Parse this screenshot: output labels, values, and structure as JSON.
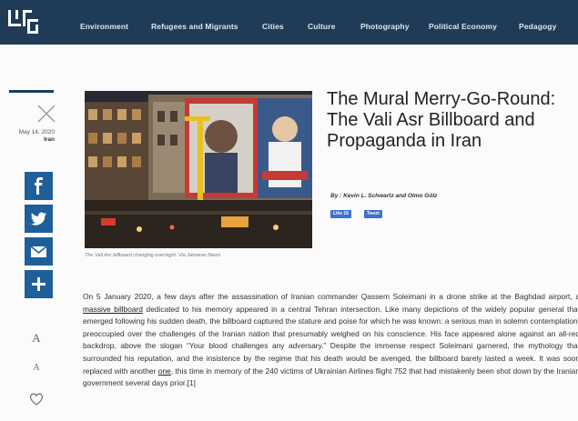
{
  "nav": {
    "items": [
      "Environment",
      "Refugees and Migrants",
      "Cities",
      "Culture",
      "Photography",
      "Political Economy",
      "Pedagogy"
    ]
  },
  "article": {
    "date": "May 14, 2020",
    "country": "Iran",
    "title": "The Mural Merry-Go-Round: The Vali Asr Billboard and Propaganda in Iran",
    "byline": "By : Kevin L. Schwartz and Olmo Gölz",
    "like_label": "Like 16",
    "tweet_label": "Tweet",
    "caption": "The Vali Asr billboard changing overnight. Via Jamaran News.",
    "body": {
      "p1": "On 5 January 2020, a few days after the assassination of Iranian commander Qassem Soleimani in a drone strike at the Baghdad airport, a ",
      "link1": "massive billboard",
      "p2": " dedicated to his memory appeared in a central Tehran intersection. Like many depictions of the widely popular general that emerged following his sudden death, the billboard captured the stature and poise for which he was known: a serious man in solemn contemplation, preoccupied over the challenges of the Iranian nation that presumably weighed on his conscience. His face appeared alone against an all-red backdrop, above the slogan “Your blood challenges any adversary.” Despite the immense respect Soleimani garnered, the mythology that surrounded his reputation, and the insistence by the regime that his death would be avenged, the billboard barely lasted a week. It was soon replaced with another ",
      "link2": "one",
      "p3": ", this time in memory of the 240 victims of Ukrainian Airlines flight 752 that had mistakenly been shot down by the Iranian government several days prior.[1]"
    }
  },
  "font_controls": {
    "large": "A",
    "small": "A"
  },
  "colors": {
    "nav_bg": "#1f3b57",
    "share_bg": "#1f5f99",
    "social_btn": "#3d72c9"
  },
  "icons": [
    "logo-icon",
    "close-icon",
    "facebook-icon",
    "twitter-icon",
    "email-icon",
    "plus-icon",
    "heart-icon"
  ]
}
